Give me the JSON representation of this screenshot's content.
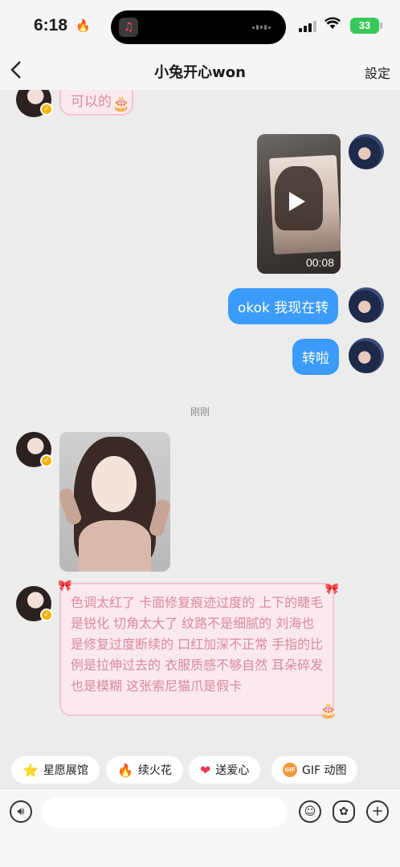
{
  "status_bar": {
    "time": "6:18",
    "battery": "33"
  },
  "nav": {
    "title": "小兔开心won",
    "settings_label": "設定"
  },
  "messages": {
    "partial_top_text": "可以的",
    "video_duration": "00:08",
    "sent_1": "okok 我现在转",
    "sent_2": "转啦",
    "timestamp": "刚刚",
    "received_text": "色调太红了 卡面修复痕迹过度的 上下的睫毛是锐化 切角太大了 纹路不是细腻的 刘海也是修复过度断续的 口红加深不正常 手指的比例是拉伸过去的 衣服质感不够自然 耳朵碎发也是模糊 这张索尼猫爪是假卡"
  },
  "quick_actions": [
    {
      "label": "星愿展馆",
      "icon": "star-icon"
    },
    {
      "label": "续火花",
      "icon": "fire-icon"
    },
    {
      "label": "送爱心",
      "icon": "heart-icon"
    },
    {
      "label": "GIF 动图",
      "icon": "gif-icon"
    }
  ],
  "input": {
    "placeholder": ""
  },
  "colors": {
    "sent_bubble": "#3a9bfa",
    "pink_bubble_bg": "#fbe9ee",
    "pink_bubble_text": "#d98aa0"
  }
}
